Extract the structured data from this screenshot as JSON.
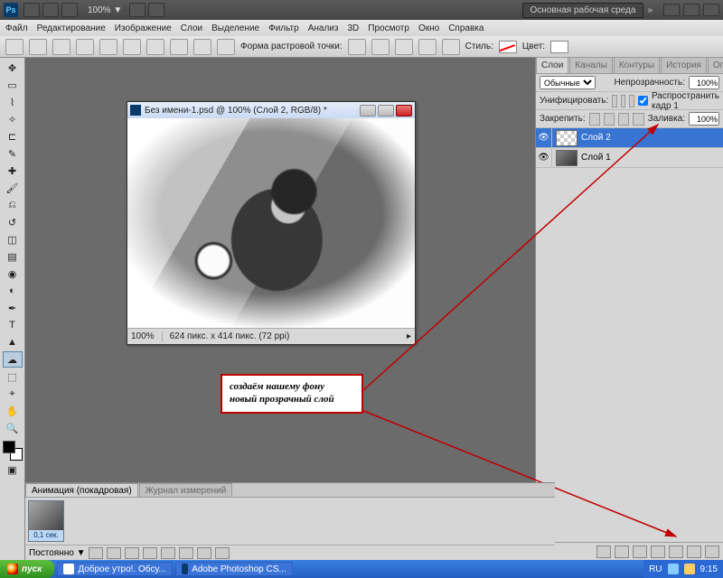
{
  "titlebar": {
    "zoom": "100% ▼",
    "workspace_label": "Основная рабочая среда",
    "chev": "»"
  },
  "menu": [
    "Файл",
    "Редактирование",
    "Изображение",
    "Слои",
    "Выделение",
    "Фильтр",
    "Анализ",
    "3D",
    "Просмотр",
    "Окно",
    "Справка"
  ],
  "optbar": {
    "shape_label": "Форма растровой точки:",
    "style_label": "Стиль:",
    "color_label": "Цвет:"
  },
  "document": {
    "title": "Без имени-1.psd @ 100% (Слой 2, RGB/8) *",
    "zoom": "100%",
    "info": "624 пикс. x 414 пикс. (72 ppi)"
  },
  "callout": "создаём нашему фону  новый прозрачный слой",
  "layers_panel": {
    "tabs": [
      "Слои",
      "Каналы",
      "Контуры",
      "История",
      "Операции"
    ],
    "blend_mode": "Обычные",
    "opacity_label": "Непрозрачность:",
    "opacity": "100%",
    "unif_label": "Унифицировать:",
    "prop_label": "Распространить кадр 1",
    "lock_label": "Закрепить:",
    "fill_label": "Заливка:",
    "fill": "100%",
    "layers": [
      {
        "name": "Слой 2",
        "selected": true,
        "thumb": "checker"
      },
      {
        "name": "Слой 1",
        "selected": false,
        "thumb": "img"
      }
    ]
  },
  "animation": {
    "tabs": [
      "Анимация (покадровая)",
      "Журнал измерений"
    ],
    "frame_time": "0,1 сек.",
    "loop": "Постоянно ▼"
  },
  "taskbar": {
    "start": "пуск",
    "tasks": [
      "Доброе утро!. Обсу...",
      "Adobe Photoshop CS..."
    ],
    "lang": "RU",
    "time": "9:15"
  }
}
